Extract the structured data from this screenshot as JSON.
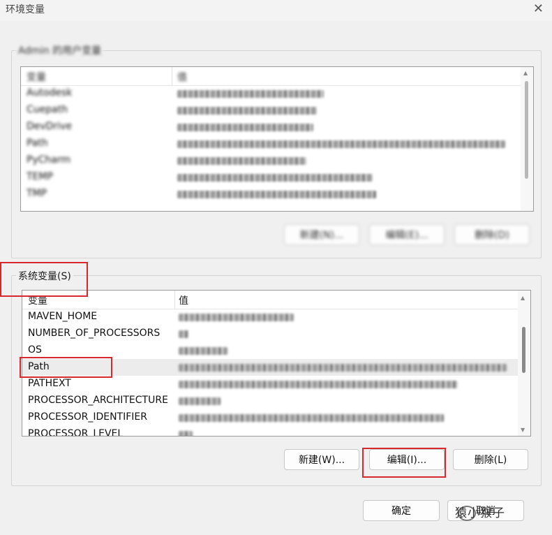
{
  "window": {
    "title": "环境变量"
  },
  "user_group": {
    "legend": "Admin 的用户变量",
    "header": {
      "col1": "变量",
      "col2": "值"
    },
    "rows": [
      {
        "name": "Autodesk",
        "value_blur_width": 210
      },
      {
        "name": "Cuepath",
        "value_blur_width": 200
      },
      {
        "name": "DevDrive",
        "value_blur_width": 195
      },
      {
        "name": "Path",
        "value_blur_width": 470
      },
      {
        "name": "PyCharm",
        "value_blur_width": 185
      },
      {
        "name": "TEMP",
        "value_blur_width": 280
      },
      {
        "name": "TMP",
        "value_blur_width": 285
      }
    ],
    "buttons": {
      "new": "新建(N)...",
      "edit": "编辑(E)...",
      "delete": "删除(D)"
    }
  },
  "system_group": {
    "legend": "系统变量(S)",
    "header": {
      "col1": "变量",
      "col2": "值"
    },
    "rows": [
      {
        "name": "MAVEN_HOME",
        "value_blur_width": 165,
        "selected": false
      },
      {
        "name": "NUMBER_OF_PROCESSORS",
        "value_blur_width": 14,
        "selected": false
      },
      {
        "name": "OS",
        "value_blur_width": 70,
        "selected": false
      },
      {
        "name": "Path",
        "value_blur_width": 470,
        "selected": true
      },
      {
        "name": "PATHEXT",
        "value_blur_width": 400,
        "selected": false
      },
      {
        "name": "PROCESSOR_ARCHITECTURE",
        "value_blur_width": 60,
        "selected": false
      },
      {
        "name": "PROCESSOR_IDENTIFIER",
        "value_blur_width": 380,
        "selected": false
      },
      {
        "name": "PROCESSOR_LEVEL",
        "value_blur_width": 20,
        "selected": false
      }
    ],
    "buttons": {
      "new": "新建(W)...",
      "edit": "编辑(I)...",
      "delete": "删除(L)"
    }
  },
  "footer": {
    "ok": "确定",
    "cancel": "取消"
  },
  "watermark": {
    "text": "猿小猴子"
  },
  "colors": {
    "highlight_red": "#d9272e",
    "blur_gray": "#9a9a9a"
  }
}
